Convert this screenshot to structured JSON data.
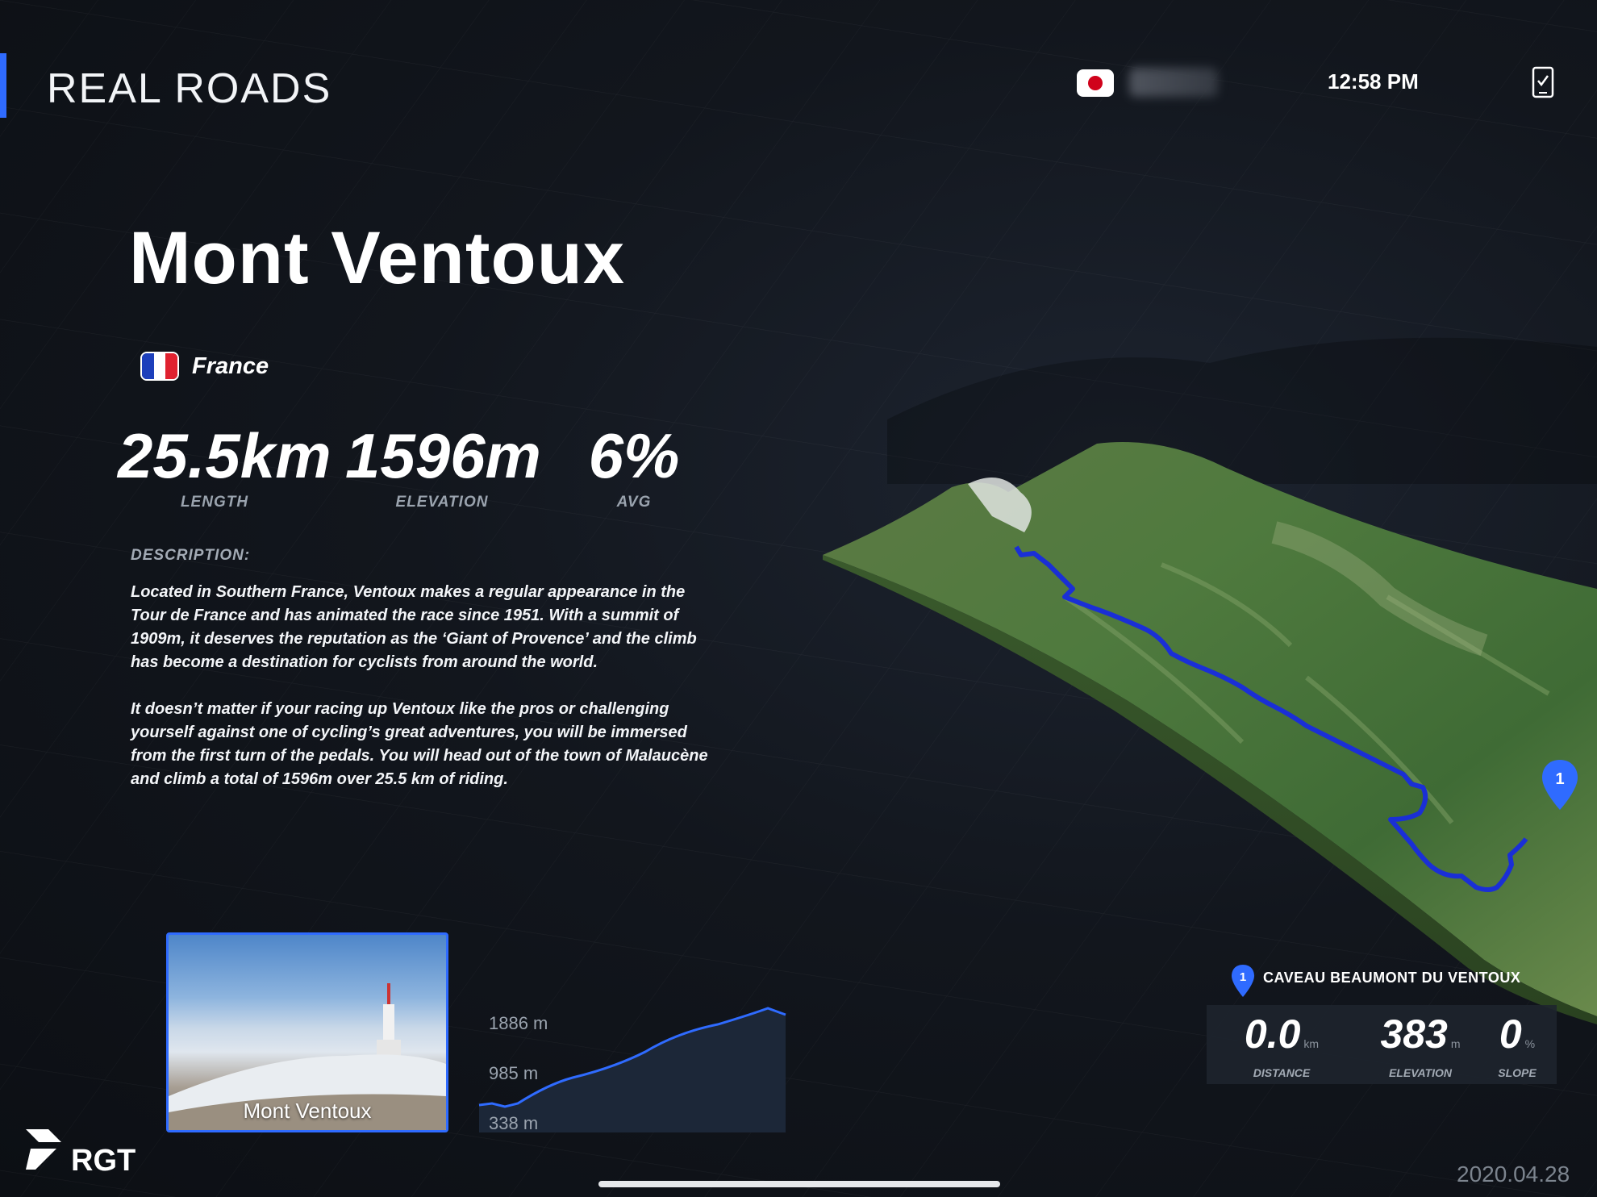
{
  "header": {
    "app_title": "REAL ROADS",
    "time": "12:58 PM",
    "user_flag_icon": "japan-flag-icon",
    "device_icon": "phone-check-icon"
  },
  "route": {
    "name": "Mont Ventoux",
    "country": "France",
    "stats": [
      {
        "value": "25.5km",
        "label": "LENGTH"
      },
      {
        "value": "1596m",
        "label": "ELEVATION"
      },
      {
        "value": "6%",
        "label": "AVG"
      }
    ],
    "description_label": "DESCRIPTION:",
    "description_paragraphs": [
      "Located in Southern France, Ventoux makes a regular appearance in the Tour de France and has animated the race since 1951. With a summit of 1909m, it deserves the reputation as the ‘Giant of Provence’ and the climb has become a destination for cyclists from around the world.",
      "It doesn’t matter if your racing up Ventoux like the pros or challenging yourself against one of cycling’s great adventures, you will be immersed from the first turn of the pedals. You will head out of the town of Malaucène and climb a total of 1596m over 25.5 km of riding."
    ],
    "photo_caption": "Mont Ventoux"
  },
  "elevation_profile": {
    "labels": [
      "1886 m",
      "985 m",
      "338 m"
    ],
    "accent_color": "#2f6bff"
  },
  "poi": {
    "marker_number": "1",
    "name": "CAVEAU BEAUMONT DU VENTOUX",
    "stats": [
      {
        "value": "0.0",
        "unit": "km",
        "label": "DISTANCE"
      },
      {
        "value": "383",
        "unit": "m",
        "label": "ELEVATION"
      },
      {
        "value": "0",
        "unit": "%",
        "label": "SLOPE"
      }
    ]
  },
  "footer": {
    "logo_text": "RGT",
    "date": "2020.04.28"
  },
  "colors": {
    "accent": "#2f6bff",
    "background": "#12161d",
    "route_line": "#1a2fd6"
  }
}
